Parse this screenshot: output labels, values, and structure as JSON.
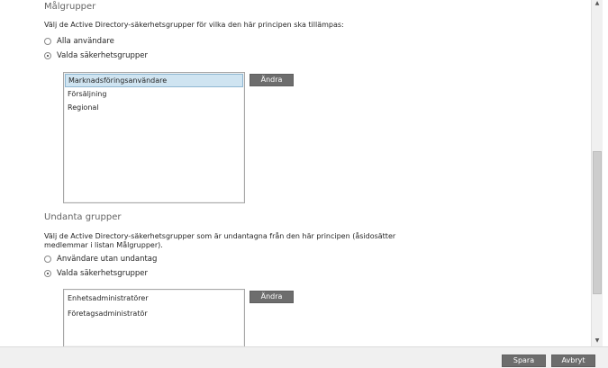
{
  "target_groups": {
    "title": "Målgrupper",
    "description": "Välj de Active Directory-säkerhetsgrupper för vilka den här principen ska tillämpas:",
    "options": [
      "Alla användare",
      "Valda säkerhetsgrupper"
    ],
    "selected_option": "Valda säkerhetsgrupper",
    "groups": [
      "Marknadsföringsanvändare",
      "Försäljning",
      "Regional"
    ],
    "selected_group": "Marknadsföringsanvändare",
    "change_button": "Ändra"
  },
  "excluded_groups": {
    "title": "Undanta grupper",
    "description_line1": "Välj de Active Directory-säkerhetsgrupper som är undantagna från den här principen (åsidosätter",
    "description_line2": "medlemmar i listan Målgrupper).",
    "options": [
      "Användare utan undantag",
      "Valda säkerhetsgrupper"
    ],
    "selected_option": "Valda säkerhetsgrupper",
    "groups": [
      "Enhetsadministratörer",
      "Företagsadministratör"
    ],
    "change_button": "Ändra"
  },
  "footer": {
    "save_button": "Spara",
    "cancel_button": "Avbryt"
  },
  "icons": {
    "scroll_up": "chevron-up-icon",
    "scroll_down": "chevron-down-icon"
  }
}
